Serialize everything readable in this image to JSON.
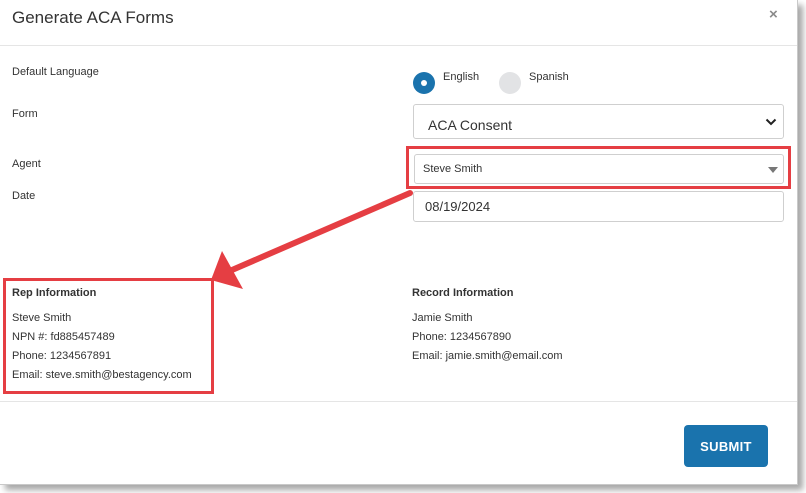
{
  "modal": {
    "title": "Generate ACA Forms",
    "close_label": "×"
  },
  "form": {
    "language_label": "Default Language",
    "language_options": [
      {
        "label": "English",
        "selected": true
      },
      {
        "label": "Spanish",
        "selected": false
      }
    ],
    "form_label": "Form",
    "form_value": "ACA Consent",
    "agent_label": "Agent",
    "agent_value": "Steve Smith",
    "date_label": "Date",
    "date_value": "08/19/2024"
  },
  "rep_info": {
    "title": "Rep Information",
    "name": "Steve Smith",
    "npn": "NPN #: fd885457489",
    "phone": "Phone: 1234567891",
    "email": "Email: steve.smith@bestagency.com"
  },
  "record_info": {
    "title": "Record Information",
    "name": "Jamie Smith",
    "phone": "Phone: 1234567890",
    "email": "Email: jamie.smith@email.com"
  },
  "footer": {
    "submit_label": "SUBMIT"
  },
  "colors": {
    "primary": "#1a73ad",
    "highlight": "#e53e43"
  },
  "icons": [
    "close-icon",
    "chevron-down-icon",
    "caret-down-icon",
    "arrow-annotation"
  ]
}
